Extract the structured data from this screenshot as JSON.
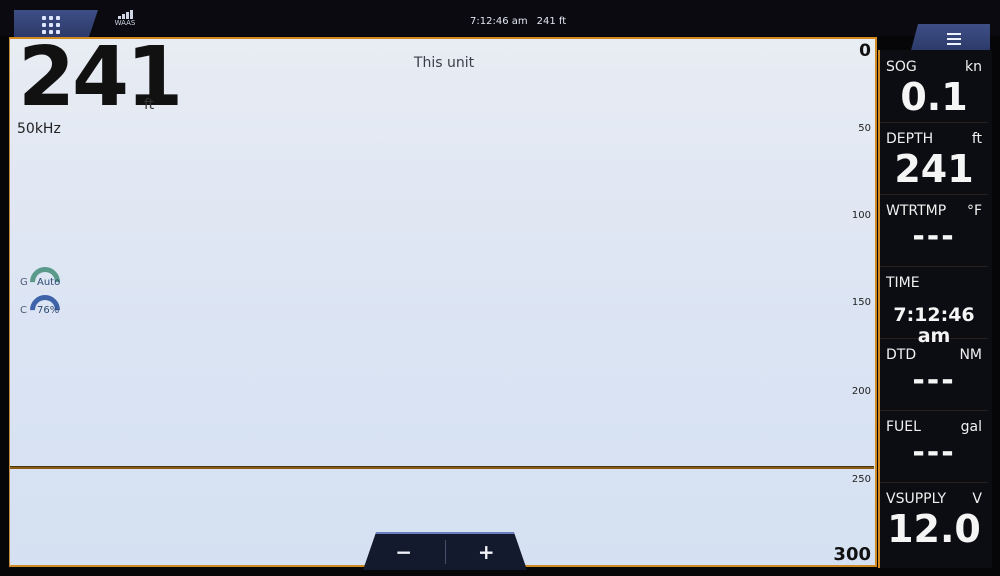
{
  "status_bar": {
    "time": "7:12:46 am",
    "depth": "241 ft",
    "gps_label": "WAAS"
  },
  "sonar": {
    "title": "This unit",
    "depth_value": "241",
    "depth_unit": "ft",
    "frequency": "50kHz",
    "gain": {
      "label": "G",
      "value": "Auto"
    },
    "color": {
      "label": "C",
      "value": "76%"
    },
    "scale": {
      "top": "0",
      "ticks": [
        "50",
        "100",
        "150",
        "200",
        "250"
      ],
      "bottom": "300"
    }
  },
  "zoom": {
    "minus": "−",
    "plus": "+"
  },
  "data_panel": [
    {
      "label": "SOG",
      "unit": "kn",
      "value": "0.1"
    },
    {
      "label": "DEPTH",
      "unit": "ft",
      "value": "241"
    },
    {
      "label": "WTRTMP",
      "unit": "°F",
      "value": "---"
    },
    {
      "label": "TIME",
      "unit": "",
      "value": "7:12:46 am"
    },
    {
      "label": "DTD",
      "unit": "NM",
      "value": "---"
    },
    {
      "label": "FUEL",
      "unit": "gal",
      "value": "---"
    },
    {
      "label": "VSUPPLY",
      "unit": "V",
      "value": "12.0"
    }
  ],
  "colors": {
    "accent_orange": "#d48a1e",
    "button_blue": "#34447a",
    "panel_bg": "#0c0d12"
  }
}
